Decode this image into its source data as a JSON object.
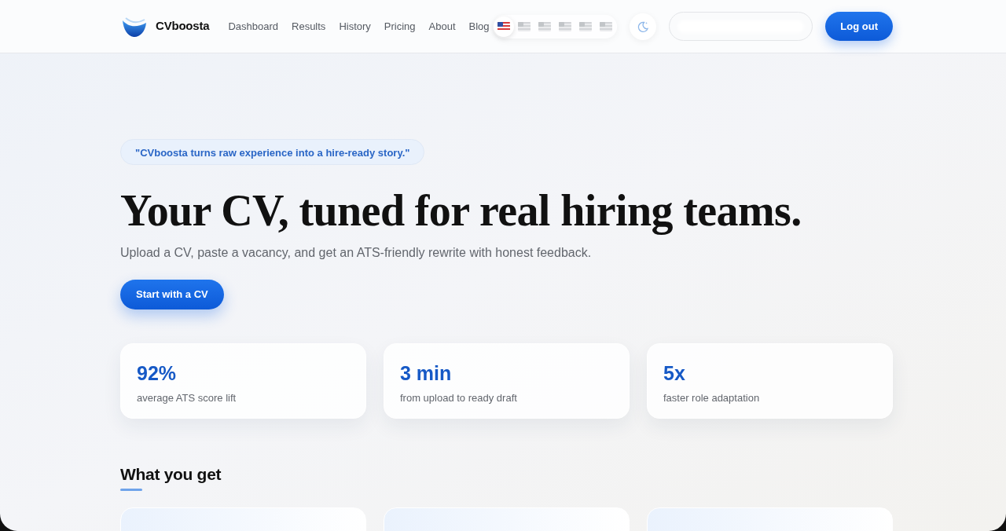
{
  "header": {
    "brand": "CVboosta",
    "nav": [
      {
        "label": "Dashboard"
      },
      {
        "label": "Results"
      },
      {
        "label": "History"
      },
      {
        "label": "Pricing"
      },
      {
        "label": "About"
      },
      {
        "label": "Blog"
      }
    ],
    "languages": [
      {
        "selected": true
      },
      {
        "selected": false
      },
      {
        "selected": false
      },
      {
        "selected": false
      },
      {
        "selected": false
      },
      {
        "selected": false
      }
    ],
    "logout": "Log out"
  },
  "hero": {
    "quote": "\"CVboosta turns raw experience into a hire-ready story.\"",
    "title": "Your CV, tuned for real hiring teams.",
    "subtitle": "Upload a CV, paste a vacancy, and get an ATS-friendly rewrite with honest feedback.",
    "cta": "Start with a CV"
  },
  "stats": [
    {
      "value": "92%",
      "label": "average ATS score lift"
    },
    {
      "value": "3 min",
      "label": "from upload to ready draft"
    },
    {
      "value": "5x",
      "label": "faster role adaptation"
    }
  ],
  "features": {
    "title": "What you get"
  }
}
